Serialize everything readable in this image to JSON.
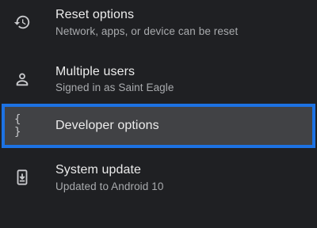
{
  "settings": {
    "items": [
      {
        "icon": "history-icon",
        "title": "Reset options",
        "subtitle": "Network, apps, or device can be reset"
      },
      {
        "icon": "person-icon",
        "title": "Multiple users",
        "subtitle": "Signed in as Saint Eagle"
      },
      {
        "icon": "braces-icon",
        "title": "Developer options",
        "icon_text": "{ }",
        "selected": true
      },
      {
        "icon": "system-update-icon",
        "title": "System update",
        "subtitle": "Updated to Android 10"
      }
    ]
  },
  "colors": {
    "background": "#1f2023",
    "selected_background": "#414245",
    "selection_border": "#1d72e3",
    "title_text": "#ececec",
    "subtitle_text": "#a9abae"
  }
}
